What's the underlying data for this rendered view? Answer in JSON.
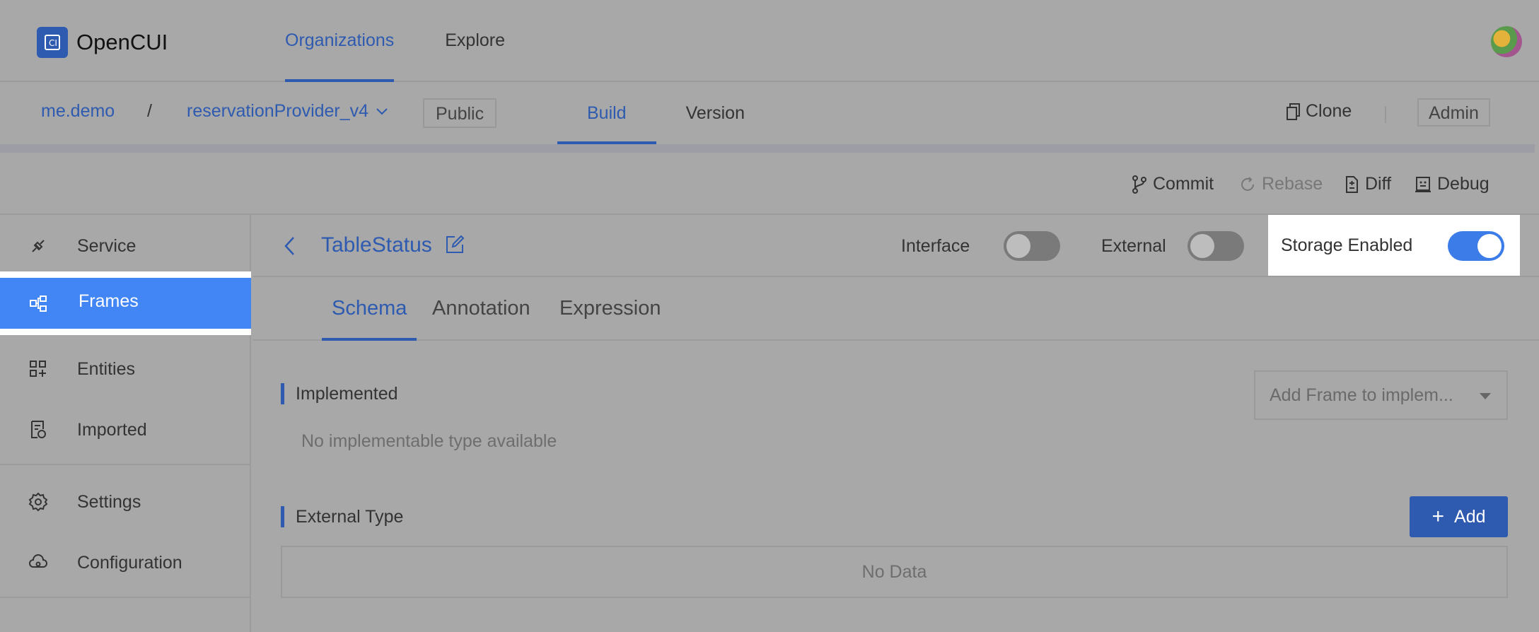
{
  "header": {
    "app_name": "OpenCUI",
    "nav": [
      {
        "label": "Organizations",
        "active": true
      },
      {
        "label": "Explore",
        "active": false
      }
    ]
  },
  "project": {
    "org": "me.demo",
    "separator": "/",
    "name": "reservationProvider_v4",
    "visibility": "Public",
    "tabs": [
      {
        "label": "Build",
        "active": true
      },
      {
        "label": "Version",
        "active": false
      }
    ],
    "clone_label": "Clone",
    "role": "Admin"
  },
  "actions": {
    "commit": "Commit",
    "rebase": "Rebase",
    "diff": "Diff",
    "debug": "Debug"
  },
  "sidebar": {
    "items": [
      {
        "label": "Service",
        "icon": "plug-icon"
      },
      {
        "label": "Frames",
        "icon": "frames-icon",
        "active": true
      },
      {
        "label": "Entities",
        "icon": "entities-icon"
      },
      {
        "label": "Imported",
        "icon": "imported-icon"
      },
      {
        "label": "Settings",
        "icon": "gear-icon"
      },
      {
        "label": "Configuration",
        "icon": "cloud-config-icon"
      }
    ]
  },
  "frame": {
    "title": "TableStatus",
    "interface_label": "Interface",
    "interface_on": false,
    "external_label": "External",
    "external_on": false,
    "storage_label": "Storage Enabled",
    "storage_on": true,
    "tabs": [
      {
        "label": "Schema",
        "active": true
      },
      {
        "label": "Annotation",
        "active": false
      },
      {
        "label": "Expression",
        "active": false
      }
    ],
    "implemented": {
      "title": "Implemented",
      "select_placeholder": "Add Frame to implem...",
      "empty_text": "No implementable type available"
    },
    "external_type": {
      "title": "External Type",
      "add_label": "Add",
      "empty_text": "No Data"
    }
  },
  "colors": {
    "accent": "#2e5bb0",
    "active_item": "#4285f4",
    "overlay_bg": "#a8a8a8"
  }
}
